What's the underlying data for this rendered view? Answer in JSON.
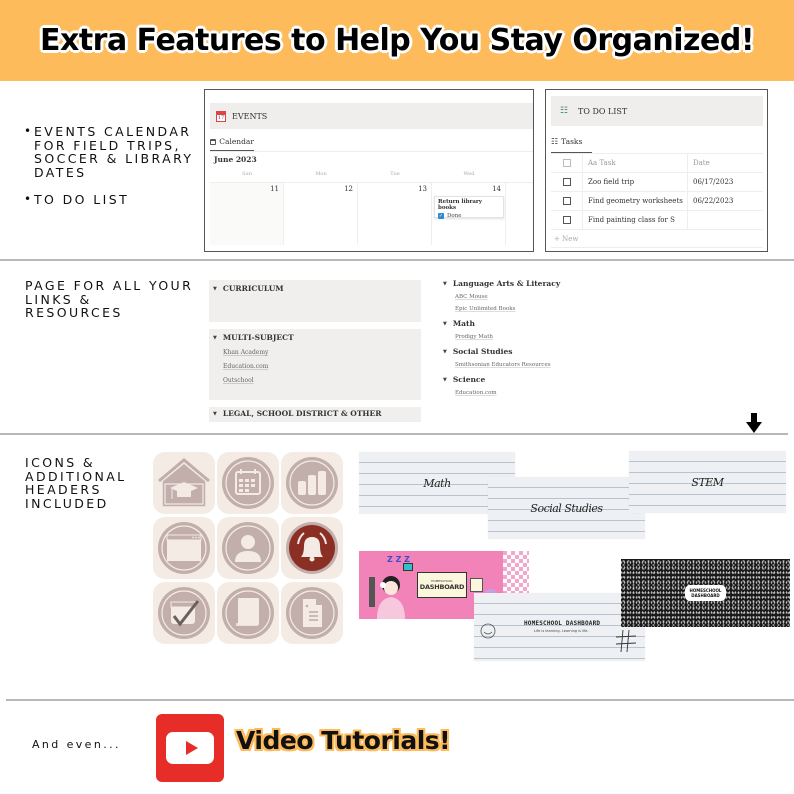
{
  "banner": {
    "title": "Extra Features to Help You Stay Organized!",
    "background_color": "#fdbb5c"
  },
  "section1": {
    "bullets": [
      "Events calendar for field trips, soccer & library dates",
      "To do list"
    ],
    "events": {
      "title": "EVENTS",
      "icon": "calendar-emoji-icon",
      "tab": "Calendar",
      "month": "June 2023",
      "weekdays": [
        "Sun",
        "Mon",
        "Tue",
        "Wed"
      ],
      "days": [
        "11",
        "12",
        "13",
        "14"
      ],
      "event": {
        "title": "Return library books",
        "status": "Done",
        "checked": true
      }
    },
    "todo": {
      "title": "TO DO LIST",
      "tab": "Tasks",
      "columns": [
        "Aa Task",
        "Date"
      ],
      "rows": [
        {
          "task": "Zoo field trip",
          "date": "06/17/2023",
          "done": false
        },
        {
          "task": "Find geometry worksheets",
          "date": "06/22/2023",
          "done": false
        },
        {
          "task": "Find painting class for S",
          "date": "",
          "done": false
        }
      ],
      "new_label": "+ New",
      "accent_color": "#3e8a5f"
    }
  },
  "section2": {
    "label": "Page for all your links & resources",
    "toggles": [
      {
        "title": "CURRICULUM",
        "links": []
      },
      {
        "title": "MULTI-SUBJECT",
        "links": [
          "Khan Academy",
          "Education.com",
          "Outschool"
        ]
      },
      {
        "title": "LEGAL, SCHOOL DISTRICT & OTHER",
        "links": []
      }
    ],
    "subjects": [
      {
        "title": "Language Arts & Literacy",
        "links": [
          "ABC Mouse",
          "Epic Unlimited Books"
        ]
      },
      {
        "title": "Math",
        "links": [
          "Prodigy Math"
        ]
      },
      {
        "title": "Social Studies",
        "links": [
          "Smithsonian Educators Resources"
        ]
      },
      {
        "title": "Science",
        "links": [
          "Education.com"
        ]
      }
    ]
  },
  "section3": {
    "label": "Icons & additional headers included",
    "icons": [
      "school-house-icon",
      "calendar-icon",
      "bar-chart-icon",
      "browser-window-icon",
      "user-icon",
      "bell-icon",
      "calendar-check-icon",
      "notebook-icon",
      "document-icon"
    ],
    "icon_color": "#c2aeab",
    "icon_accent_color": "#8b2f24",
    "tile_color": "#f4ebe5",
    "paper_headers": [
      "Math",
      "Social Studies",
      "STEM"
    ],
    "dashboard_headers": {
      "pink": {
        "small": "HOMESCHOOL",
        "big": "DASHBOARD",
        "zzz": "Z Z Z"
      },
      "notebook": {
        "title": "HOMESCHOOL DASHBOARD",
        "subtitle": "Life is learning. Learning is life."
      },
      "composition": {
        "line1": "HOMESCHOOL",
        "line2": "DASHBOARD"
      }
    }
  },
  "section4": {
    "lead": "And even...",
    "title": "Video Tutorials!",
    "logo_color": "#e62d27"
  }
}
